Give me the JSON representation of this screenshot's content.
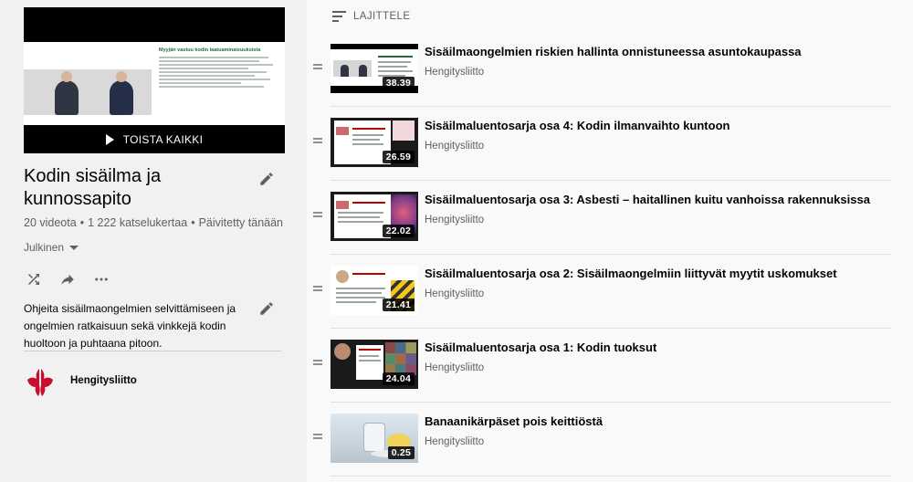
{
  "playlist": {
    "play_all_label": "TOISTA KAIKKI",
    "title": "Kodin sisäilma ja kunnossapito",
    "stats": {
      "videos": "20 videota",
      "views": "1 222 katselukertaa",
      "updated": "Päivitetty tänään",
      "separator": "•"
    },
    "privacy": "Julkinen",
    "description": "Ohjeita sisäilmaongelmien selvittämiseen ja ongelmien ratkaisuun sekä vinkkejä kodin huoltoon ja puhtaana pitoon.",
    "channel": "Hengitysliitto",
    "hero_slide_title": "Myyjän vastuu kodin laatuaminaisuuksista"
  },
  "sort": {
    "label": "LAJITTELE"
  },
  "videos": [
    {
      "title": "Sisäilmaongelmien riskien hallinta onnistuneessa asuntokaupassa",
      "channel": "Hengitysliitto",
      "duration": "38.39",
      "thumb": "webinar"
    },
    {
      "title": "Sisäilmaluentosarja osa 4: Kodin ilmanvaihto kuntoon",
      "channel": "Hengitysliitto",
      "duration": "26.59",
      "thumb": "slide-pink"
    },
    {
      "title": "Sisäilmaluentosarja osa 3: Asbesti – haitallinen kuitu vanhoissa rakennuksissa",
      "channel": "Hengitysliitto",
      "duration": "22.02",
      "thumb": "slide-lungs"
    },
    {
      "title": "Sisäilmaluentosarja osa 2: Sisäilmaongelmiin liittyvät myytit uskomukset",
      "channel": "Hengitysliitto",
      "duration": "21.41",
      "thumb": "slide-yellow"
    },
    {
      "title": "Sisäilmaluentosarja osa 1: Kodin tuoksut",
      "channel": "Hengitysliitto",
      "duration": "24.04",
      "thumb": "slide-mosaic"
    },
    {
      "title": "Banaanikärpäset pois keittiöstä",
      "channel": "Hengitysliitto",
      "duration": "0.25",
      "thumb": "kitchen"
    }
  ],
  "colors": {
    "accent_red": "#c8102e",
    "text_primary": "#030303",
    "text_secondary": "#606060",
    "sidebar_bg": "#f1f1f1",
    "page_bg": "#f9f9f9"
  },
  "icons": {
    "edit": "pencil-icon",
    "shuffle": "shuffle-icon",
    "share": "share-icon",
    "more": "more-horizontal-icon",
    "sort": "sort-icon",
    "drag": "drag-handle-icon",
    "play": "play-icon"
  }
}
